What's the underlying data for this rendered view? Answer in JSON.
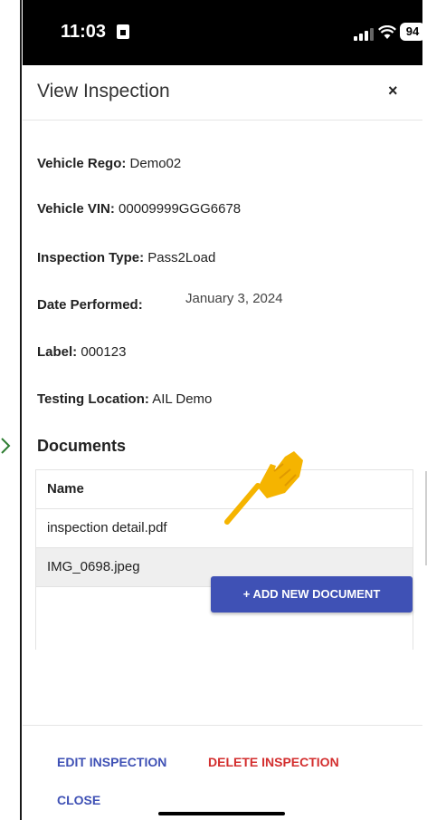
{
  "status_bar": {
    "time": "11:03",
    "battery": "94"
  },
  "dialog": {
    "title": "View Inspection",
    "close_icon": "×"
  },
  "details": [
    {
      "label": "Vehicle Rego:",
      "value": " Demo02"
    },
    {
      "label": "Vehicle VIN:",
      "value": " 00009999GGG6678"
    },
    {
      "label": "Inspection Type:",
      "value": " Pass2Load"
    },
    {
      "label": "Date Performed:",
      "value": ""
    },
    {
      "label": "Label:",
      "value": " 000123"
    },
    {
      "label": "Testing Location:",
      "value": " AIL Demo"
    }
  ],
  "date_performed_value": "January 3, 2024",
  "documents": {
    "title": "Documents",
    "column_name": "Name",
    "rows": [
      "inspection detail.pdf",
      "IMG_0698.jpeg"
    ],
    "add_button": "+ ADD NEW DOCUMENT"
  },
  "footer": {
    "edit": "EDIT INSPECTION",
    "delete": "DELETE INSPECTION",
    "close": "CLOSE"
  },
  "colors": {
    "primary": "#3f51b5",
    "edit": "#3f51b5",
    "delete": "#d32f2f",
    "pointer": "#f5b400"
  }
}
